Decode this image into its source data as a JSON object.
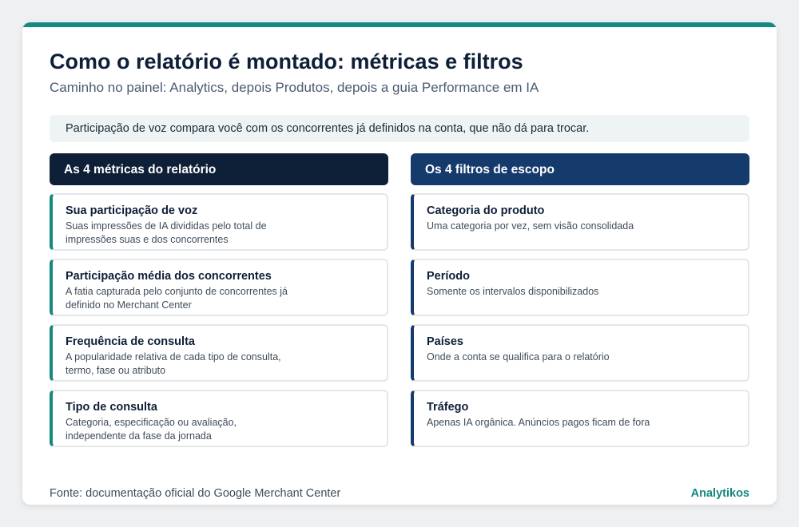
{
  "title": "Como o relatório é montado: métricas e filtros",
  "subtitle": "Caminho no painel: Analytics, depois Produtos, depois a guia Performance em IA",
  "note": "Participação de voz compara você com os concorrentes já definidos na conta, que não dá para trocar.",
  "metrics": {
    "header": "As 4 métricas do relatório",
    "items": [
      {
        "title": "Sua participação de voz",
        "desc": "Suas impressões de IA divididas pelo total de impressões suas e dos concorrentes"
      },
      {
        "title": "Participação média dos concorrentes",
        "desc": "A fatia capturada pelo conjunto de concorrentes já definido no Merchant Center"
      },
      {
        "title": "Frequência de consulta",
        "desc": "A popularidade relativa de cada tipo de consulta, termo, fase ou atributo"
      },
      {
        "title": "Tipo de consulta",
        "desc": "Categoria, especificação ou avaliação, independente da fase da jornada"
      }
    ]
  },
  "filters": {
    "header": "Os 4 filtros de escopo",
    "items": [
      {
        "title": "Categoria do produto",
        "desc": "Uma categoria por vez, sem visão consolidada"
      },
      {
        "title": "Período",
        "desc": "Somente os intervalos disponibilizados"
      },
      {
        "title": "Países",
        "desc": "Onde a conta se qualifica para o relatório"
      },
      {
        "title": "Tráfego",
        "desc": "Apenas IA orgânica. Anúncios pagos ficam de fora"
      }
    ]
  },
  "footer": {
    "source": "Fonte: documentação oficial do Google Merchant Center",
    "brand": "Analytikos"
  },
  "colors": {
    "accent_teal": "#14897f",
    "navy_dark": "#0e1f38",
    "navy_blue": "#153b6d"
  }
}
